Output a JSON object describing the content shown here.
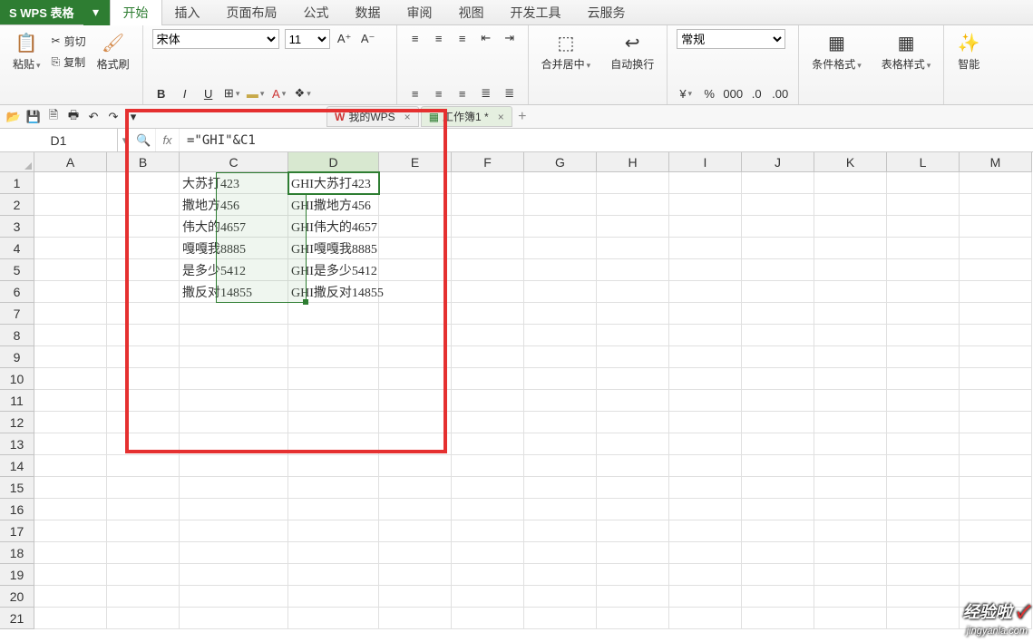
{
  "app": {
    "logo_text": "S WPS 表格"
  },
  "menu": {
    "items": [
      "开始",
      "插入",
      "页面布局",
      "公式",
      "数据",
      "审阅",
      "视图",
      "开发工具",
      "云服务"
    ],
    "active_index": 0
  },
  "ribbon": {
    "clipboard": {
      "paste": "粘贴",
      "cut": "剪切",
      "copy": "复制",
      "format_painter": "格式刷"
    },
    "font": {
      "name": "宋体",
      "size": "11",
      "bold": "B",
      "italic": "I",
      "underline": "U"
    },
    "align": {
      "merge_center": "合并居中",
      "wrap_text": "自动换行"
    },
    "number": {
      "format": "常规"
    },
    "styles": {
      "conditional": "条件格式",
      "table_style": "表格样式"
    },
    "intelligent": "智能"
  },
  "doctabs": {
    "tab1": "我的WPS",
    "tab2": "工作簿1 *",
    "add": "+"
  },
  "namebox": {
    "cell_ref": "D1"
  },
  "formula": {
    "value": "=\"GHI\"&C1"
  },
  "columns": [
    "A",
    "B",
    "C",
    "D",
    "E",
    "F",
    "G",
    "H",
    "I",
    "J",
    "K",
    "L",
    "M"
  ],
  "selected_col_index": 3,
  "data_rows": [
    {
      "c": "大苏打423",
      "d": "GHI大苏打423"
    },
    {
      "c": "撒地方456",
      "d": "GHI撒地方456"
    },
    {
      "c": "伟大的4657",
      "d": "GHI伟大的4657"
    },
    {
      "c": "嘎嘎我8885",
      "d": "GHI嘎嘎我8885"
    },
    {
      "c": "是多少5412",
      "d": "GHI是多少5412"
    },
    {
      "c": "撒反对14855",
      "d": "GHI撒反对14855"
    }
  ],
  "total_rows": 21,
  "watermark": {
    "main": "经验啦",
    "check": "✓",
    "sub": "jingyanla.com"
  }
}
